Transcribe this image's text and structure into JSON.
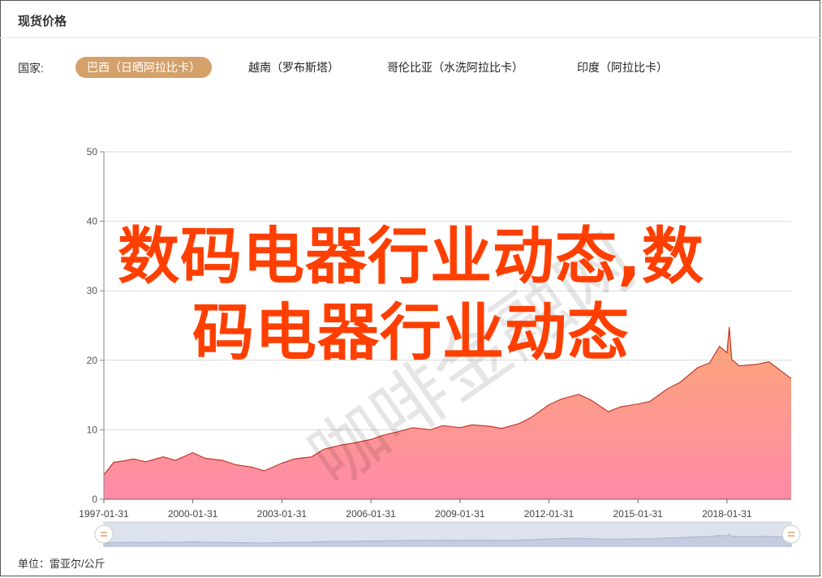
{
  "panel": {
    "title": "现货价格",
    "country_label": "国家:",
    "tabs": [
      {
        "label": "巴西（日晒阿拉比卡）",
        "active": true
      },
      {
        "label": "越南（罗布斯塔）",
        "active": false
      },
      {
        "label": "哥伦比亚（水洗阿拉比卡）",
        "active": false
      },
      {
        "label": "印度（阿拉比卡）",
        "active": false
      }
    ],
    "unit": "单位：雷亚尔/公斤"
  },
  "overlay": {
    "line1": "数码电器行业动态,数",
    "line2": "码电器行业动态",
    "watermark": "咖啡金融网"
  },
  "colors": {
    "accent": "#d4a16a",
    "line": "#c0392b",
    "fill_top": "#fca777",
    "fill_bottom": "#ff8aa8",
    "overlay_text": "#ff3f00"
  },
  "chart_data": {
    "type": "area",
    "title": "",
    "xlabel": "",
    "ylabel": "",
    "ylim": [
      0,
      50
    ],
    "yticks": [
      0,
      10,
      20,
      30,
      40,
      50
    ],
    "xticks": [
      "1997-01-31",
      "2000-01-31",
      "2003-01-31",
      "2006-01-31",
      "2009-01-31",
      "2012-01-31",
      "2015-01-31",
      "2018-01-31"
    ],
    "xlim": [
      "1997-01-31",
      "2020-03-31"
    ],
    "grid": true,
    "series": [
      {
        "x": [
          "1997-01-31",
          "1997-05-31",
          "1997-09-30",
          "1998-01-31",
          "1998-06-30",
          "1999-01-31",
          "1999-06-30",
          "2000-01-31",
          "2000-06-30",
          "2001-01-31",
          "2001-06-30",
          "2002-01-31",
          "2002-06-30",
          "2003-01-31",
          "2003-06-30",
          "2004-01-31",
          "2004-06-30",
          "2005-01-31",
          "2005-06-30",
          "2006-01-31",
          "2006-06-30",
          "2007-01-31",
          "2007-06-30",
          "2008-01-31",
          "2008-06-30",
          "2009-01-31",
          "2009-06-30",
          "2010-01-31",
          "2010-06-30",
          "2011-01-31",
          "2011-06-30",
          "2012-01-31",
          "2012-06-30",
          "2013-01-31",
          "2013-06-30",
          "2014-01-31",
          "2014-06-30",
          "2015-01-31",
          "2015-06-30",
          "2016-01-31",
          "2016-06-30",
          "2017-01-31",
          "2017-06-30",
          "2017-10-31",
          "2018-01-31",
          "2018-02-28",
          "2018-03-31",
          "2018-06-30",
          "2019-01-31",
          "2019-06-30",
          "2019-10-31",
          "2020-01-31",
          "2020-03-31"
        ],
        "values": [
          3.5,
          5.3,
          5.5,
          5.8,
          5.4,
          6.1,
          5.6,
          6.7,
          5.9,
          5.6,
          5.0,
          4.6,
          4.1,
          5.2,
          5.8,
          6.1,
          7.2,
          7.8,
          8.1,
          8.6,
          9.2,
          9.8,
          10.3,
          10.0,
          10.6,
          10.3,
          10.7,
          10.5,
          10.2,
          10.9,
          11.8,
          13.6,
          14.4,
          15.1,
          14.3,
          12.6,
          13.3,
          13.7,
          14.1,
          15.9,
          16.8,
          18.9,
          19.6,
          22.0,
          21.1,
          24.8,
          20.1,
          19.2,
          19.4,
          19.8,
          18.7,
          17.9,
          17.4
        ]
      }
    ]
  }
}
